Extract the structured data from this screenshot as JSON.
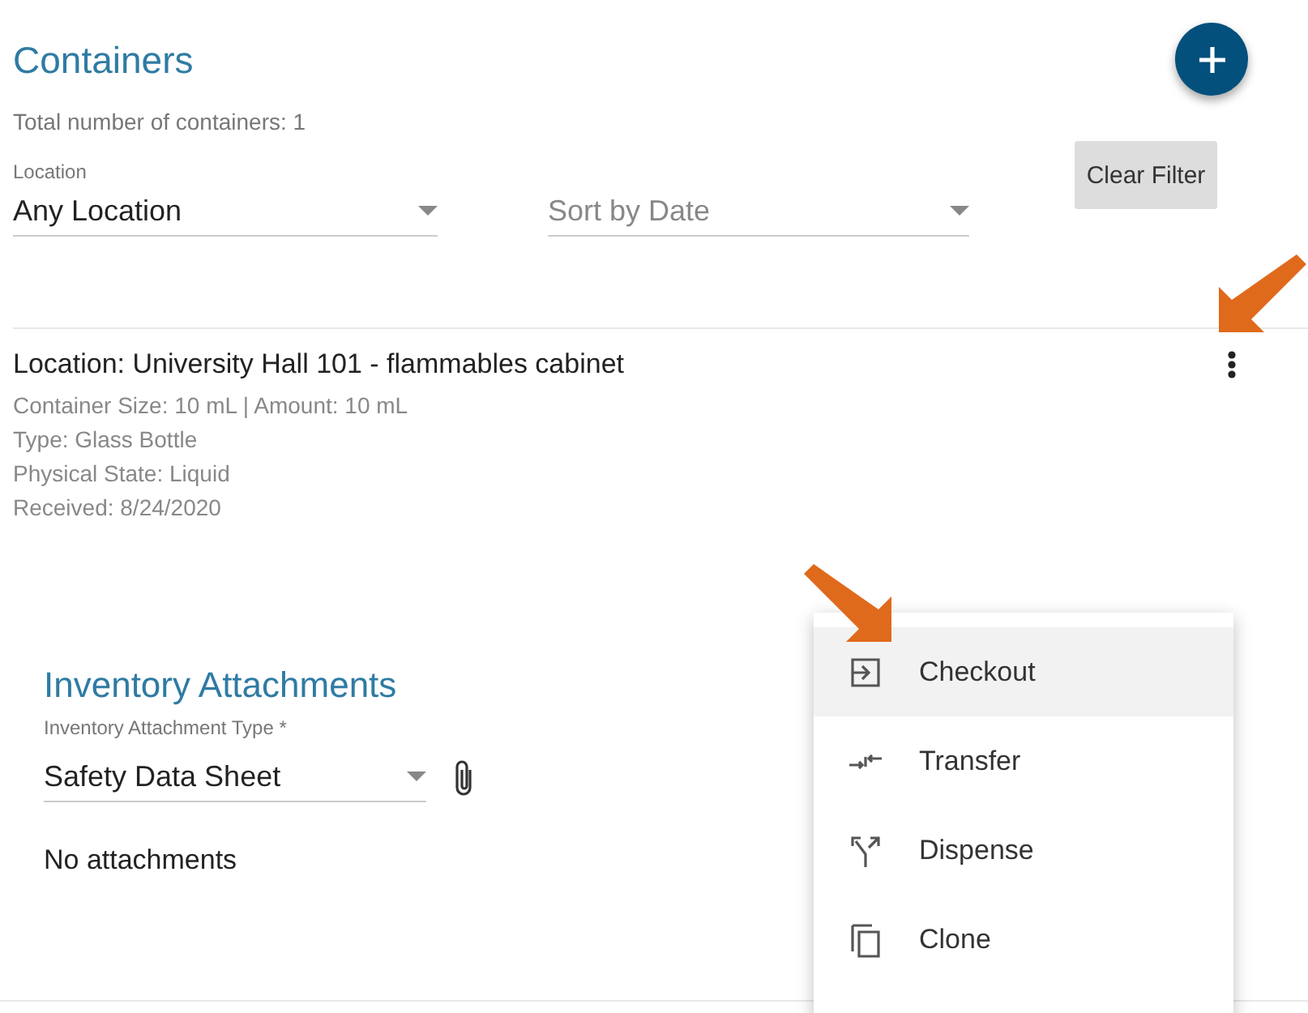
{
  "header": {
    "title": "Containers",
    "total": "Total number of containers: 1"
  },
  "filters": {
    "location": {
      "label": "Location",
      "value": "Any Location"
    },
    "sort": {
      "placeholder": "Sort by Date"
    },
    "clear_button": "Clear Filter"
  },
  "container": {
    "location": "Location: University Hall 101 - flammables cabinet",
    "details": [
      "Container Size: 10 mL | Amount: 10 mL",
      "Type: Glass Bottle",
      "Physical State: Liquid",
      "Received: 8/24/2020"
    ]
  },
  "attachments": {
    "title": "Inventory Attachments",
    "type_field": {
      "label": "Inventory Attachment Type *",
      "value": "Safety Data Sheet"
    },
    "empty": "No attachments"
  },
  "menu": [
    {
      "kind": "checkout",
      "label": "Checkout",
      "selected": true
    },
    {
      "kind": "transfer",
      "label": "Transfer",
      "selected": false
    },
    {
      "kind": "dispense",
      "label": "Dispense",
      "selected": false
    },
    {
      "kind": "clone",
      "label": "Clone",
      "selected": false
    }
  ]
}
